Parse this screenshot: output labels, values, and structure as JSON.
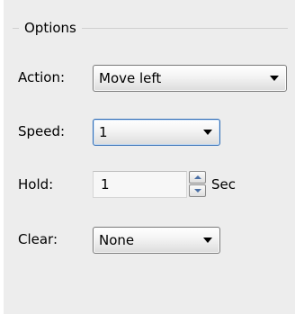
{
  "options": {
    "title": "Options",
    "action": {
      "label": "Action:",
      "value": "Move left"
    },
    "speed": {
      "label": "Speed:",
      "value": "1"
    },
    "hold": {
      "label": "Hold:",
      "value": "1",
      "unit": "Sec"
    },
    "clear": {
      "label": "Clear:",
      "value": "None"
    }
  },
  "icons": {
    "dropdown": "chevron-down-icon",
    "spin_up": "arrow-up-icon",
    "spin_down": "arrow-down-icon"
  }
}
